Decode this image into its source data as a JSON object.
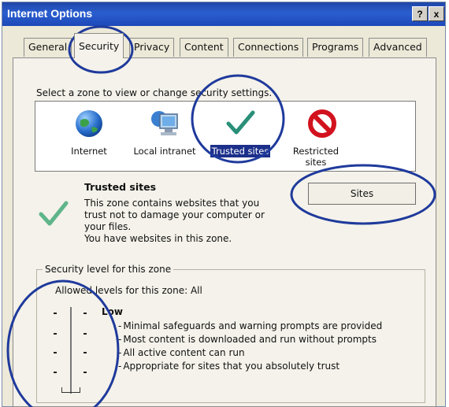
{
  "window": {
    "title": "Internet Options",
    "help_btn": "?",
    "close_btn": "x"
  },
  "tabs": [
    "General",
    "Security",
    "Privacy",
    "Content",
    "Connections",
    "Programs",
    "Advanced"
  ],
  "active_tab": "Security",
  "zones": {
    "prompt": "Select a zone to view or change security settings.",
    "items": [
      "Internet",
      "Local intranet",
      "Trusted sites",
      "Restricted sites"
    ],
    "selected": "Trusted sites"
  },
  "description": {
    "title": "Trusted sites",
    "body": "This zone contains websites that you\ntrust not to damage your computer or\nyour files.\nYou have websites in this zone."
  },
  "sites_button": "Sites",
  "security_level": {
    "group_label": "Security level for this zone",
    "allowed": "Allowed levels for this zone: All",
    "level": "Low",
    "bullets": [
      "Minimal safeguards and warning prompts are provided",
      "Most content is downloaded and run without prompts",
      "All active content can run",
      "Appropriate for sites that you absolutely trust"
    ]
  },
  "colors": {
    "title_bar": "#1f46a8",
    "selection": "#1c2f8a",
    "annotation_circle": "#1f3a9c"
  },
  "icons": [
    "globe-icon",
    "intranet-computer-icon",
    "checkmark-icon",
    "no-entry-icon"
  ]
}
